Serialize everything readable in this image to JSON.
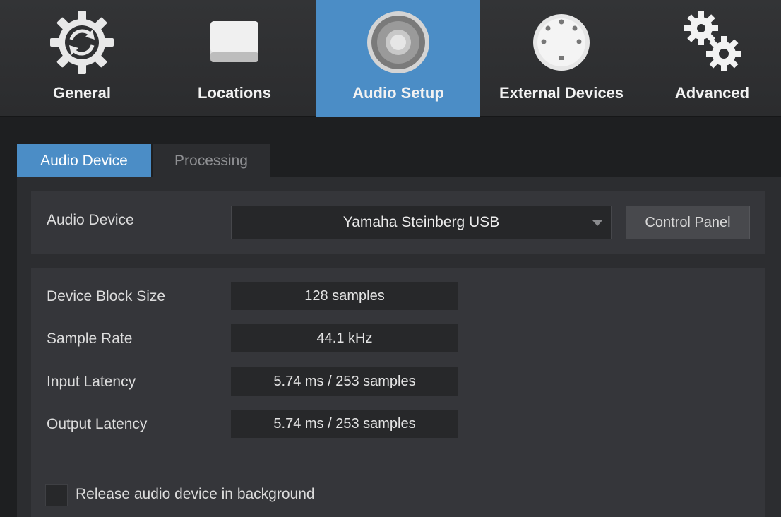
{
  "categories": [
    {
      "label": "General",
      "icon": "sync-gear-icon"
    },
    {
      "label": "Locations",
      "icon": "drive-icon"
    },
    {
      "label": "Audio Setup",
      "icon": "speaker-icon",
      "active": true
    },
    {
      "label": "External Devices",
      "icon": "midi-port-icon"
    },
    {
      "label": "Advanced",
      "icon": "gears-icon"
    }
  ],
  "subtabs": [
    {
      "label": "Audio Device",
      "active": true
    },
    {
      "label": "Processing"
    }
  ],
  "device": {
    "label": "Audio Device",
    "selected": "Yamaha Steinberg USB",
    "control_panel_label": "Control Panel"
  },
  "settings": [
    {
      "label": "Device Block Size",
      "value": "128 samples"
    },
    {
      "label": "Sample Rate",
      "value": "44.1 kHz"
    },
    {
      "label": "Input Latency",
      "value": "5.74 ms / 253 samples"
    },
    {
      "label": "Output Latency",
      "value": "5.74 ms / 253 samples"
    }
  ],
  "release_option": {
    "label": "Release audio device in background",
    "checked": false
  },
  "colors": {
    "accent": "#4b8dc6",
    "background": "#1e1f21",
    "panel": "#35363a"
  }
}
